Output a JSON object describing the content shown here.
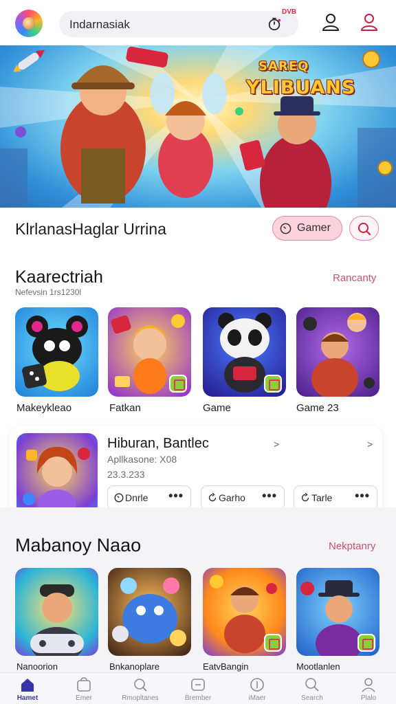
{
  "header": {
    "search_text": "Indarnasiak",
    "badge_text": "DVB"
  },
  "banner": {
    "logo_line1": "SAREQ",
    "logo_line2": "YLIBUANS"
  },
  "title_row": {
    "title": "KlrlanasHaglar Urrina",
    "gamer_label": "Gamer"
  },
  "categories": {
    "title": "Kaarectriah",
    "subtitle": "Nefevsin 1rs1230l",
    "see_all": "Rancanty",
    "tiles": [
      {
        "label": "Makeykleao",
        "icon": "panda-character-icon"
      },
      {
        "label": "Fatkan",
        "icon": "fairy-character-icon"
      },
      {
        "label": "Game",
        "icon": "panda-robot-icon"
      },
      {
        "label": "Game 23",
        "icon": "adventurers-icon"
      }
    ]
  },
  "featured": {
    "title": "Hiburan, Bantlec",
    "subtitle": "Apllkasone: X08",
    "count": "23.3.233",
    "arrows": [
      ">",
      ">"
    ],
    "pills": [
      {
        "label": "Dnrle",
        "dots": "•••"
      },
      {
        "label": "Garho",
        "dots": "•••"
      },
      {
        "label": "Tarle",
        "dots": "•••"
      }
    ]
  },
  "lower": {
    "title": "Mabanoy Naao",
    "see_all": "Nekptanry",
    "tiles": [
      {
        "label": "Nanoorion",
        "icon": "gamer-with-controller-icon"
      },
      {
        "label": "Bnkanoplare",
        "icon": "blue-creature-icon"
      },
      {
        "label": "EatvBangin",
        "icon": "explorer-character-icon"
      },
      {
        "label": "Mootlanlen",
        "icon": "adventurer-hat-icon"
      }
    ]
  },
  "nav": {
    "items": [
      {
        "label": "Hamet",
        "icon": "home-icon",
        "active": true
      },
      {
        "label": "Emer",
        "icon": "bag-icon"
      },
      {
        "label": "Rmopltanes",
        "icon": "search-icon"
      },
      {
        "label": "Brember",
        "icon": "tag-icon"
      },
      {
        "label": "iMaer",
        "icon": "coin-icon"
      },
      {
        "label": "Search",
        "icon": "magnifier-icon"
      },
      {
        "label": "Plalo",
        "icon": "profile-icon"
      }
    ]
  },
  "colors": {
    "accent": "#c9506e",
    "nav_active": "#3a36a8",
    "gamer_button_bg": "#fbd3dd"
  }
}
